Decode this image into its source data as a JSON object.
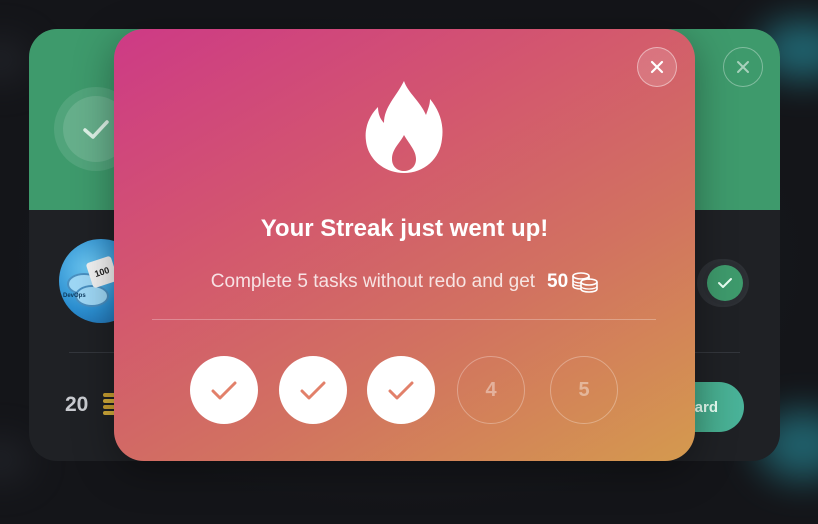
{
  "back_card": {
    "reward_amount": "20",
    "claim_button_label": "ard",
    "header_color": "#3e9a6c",
    "avatar_book_label": "100",
    "avatar_tag": "DevOps"
  },
  "modal": {
    "title": "Your Streak just went up!",
    "subtitle": "Complete 5 tasks without redo and get",
    "reward_amount": "50",
    "icon": "fire-icon",
    "close_icon": "close-icon",
    "gradient": [
      "#cd3a86",
      "#d3566f",
      "#d27260",
      "#d49a4e"
    ],
    "steps": [
      {
        "label": "",
        "done": true
      },
      {
        "label": "",
        "done": true
      },
      {
        "label": "",
        "done": true
      },
      {
        "label": "4",
        "done": false
      },
      {
        "label": "5",
        "done": false
      }
    ]
  }
}
